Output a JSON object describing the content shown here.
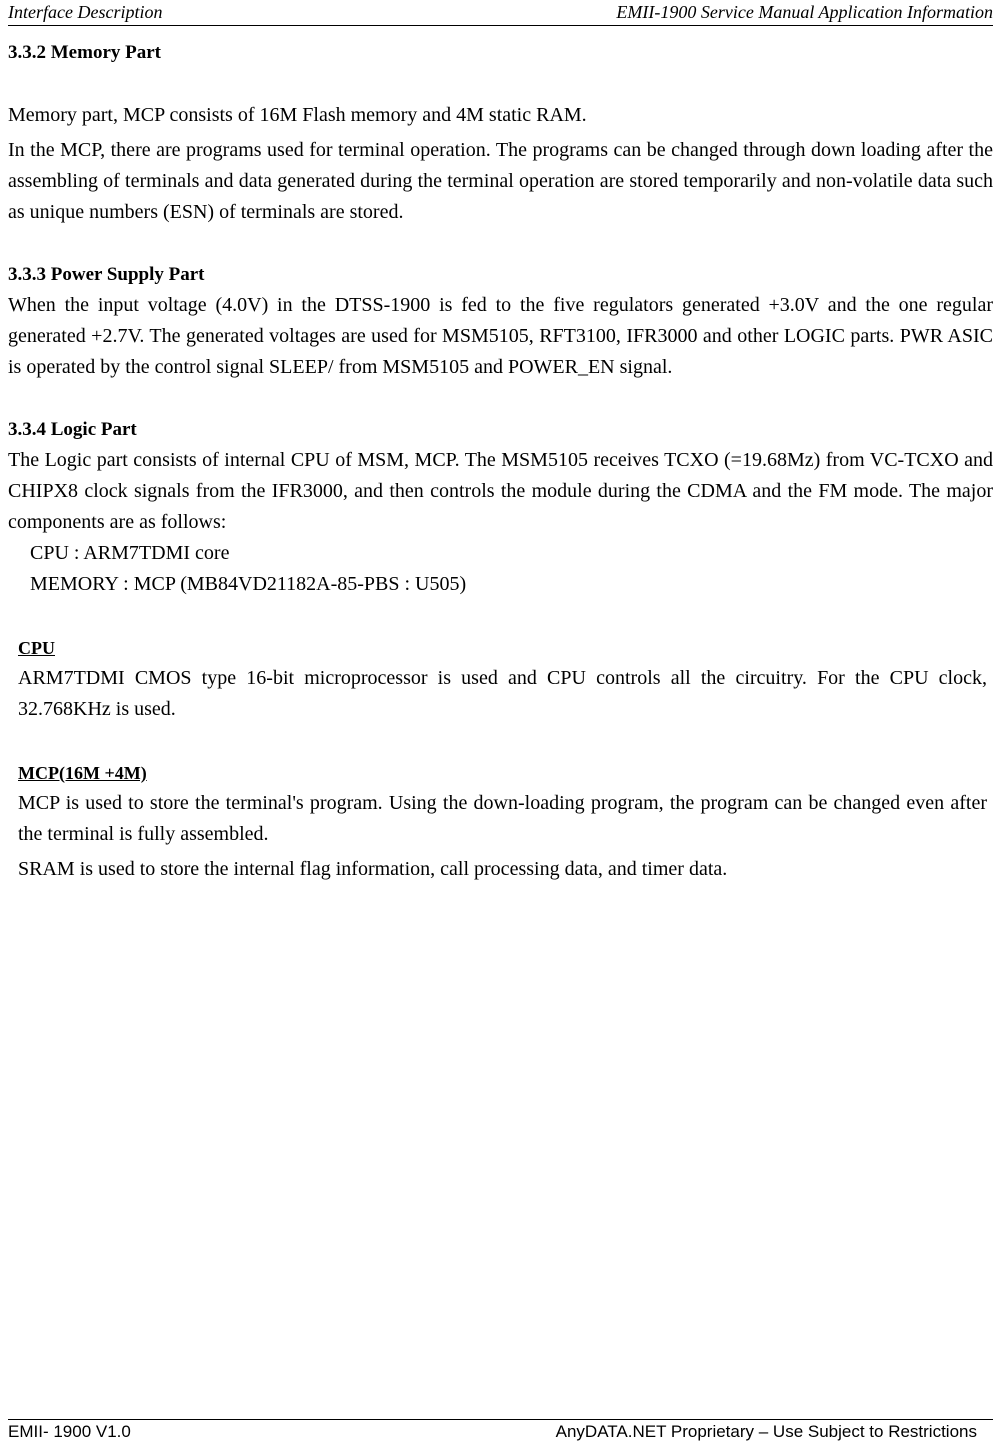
{
  "header": {
    "left": "Interface Description",
    "right": "EMII-1900 Service Manual Application Information"
  },
  "sections": {
    "memory": {
      "heading": "3.3.2 Memory Part",
      "para1": "Memory part, MCP consists of 16M Flash memory and 4M static RAM.",
      "para2": "In the MCP, there are programs used for terminal operation. The programs can be changed through down loading after the assembling of terminals and data generated during the terminal operation are stored temporarily and non-volatile data such as unique numbers (ESN) of terminals are stored."
    },
    "power": {
      "heading": "3.3.3 Power Supply Part",
      "para": "When the input voltage (4.0V) in the DTSS-1900 is fed to the five regulators generated +3.0V and the one regular generated +2.7V. The generated voltages are used for MSM5105, RFT3100, IFR3000 and other LOGIC parts. PWR ASIC is operated by the control signal SLEEP/ from MSM5105 and POWER_EN signal."
    },
    "logic": {
      "heading": "3.3.4 Logic Part",
      "para": "The Logic part consists of internal CPU of MSM, MCP. The MSM5105 receives TCXO (=19.68Mz) from VC-TCXO and CHIPX8 clock signals from the IFR3000, and then controls the module during the CDMA and the FM mode. The major components are as follows:",
      "items": {
        "cpu": "CPU : ARM7TDMI core",
        "memory": "MEMORY : MCP (MB84VD21182A-85-PBS : U505)"
      }
    },
    "cpu": {
      "heading": "CPU",
      "para": "ARM7TDMI CMOS type 16-bit microprocessor is used and CPU controls all the circuitry. For the CPU clock, 32.768KHz is used."
    },
    "mcp": {
      "heading": "MCP(16M +4M)",
      "para1": "MCP is used to store the terminal's program. Using the down-loading program, the program can be changed even after the terminal is fully assembled.",
      "para2": "SRAM is used to store the internal flag information, call processing data, and timer data."
    }
  },
  "footer": {
    "left": "EMII- 1900 V1.0",
    "right": "AnyDATA.NET Proprietary –  Use Subject to Restrictions"
  }
}
